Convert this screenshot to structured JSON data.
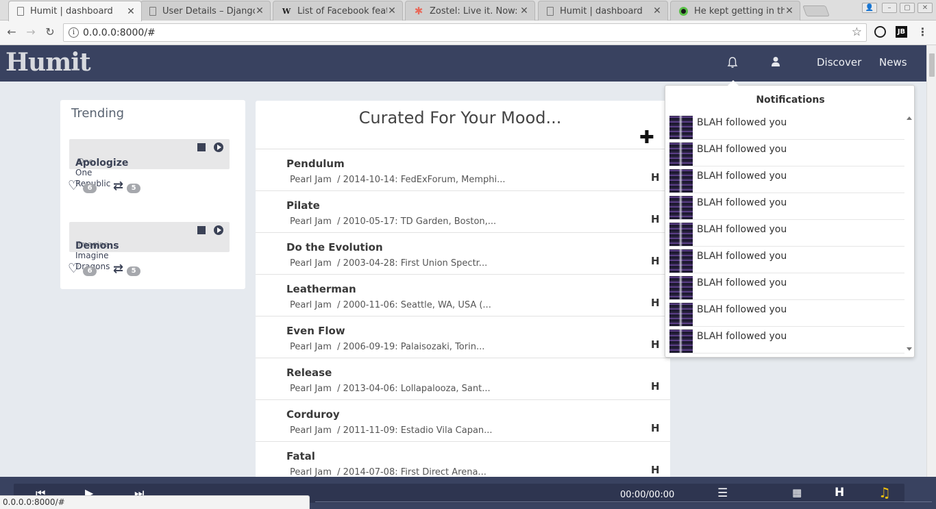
{
  "browser": {
    "tabs": [
      {
        "title": "Humit | dashboard",
        "icon": "page-icon"
      },
      {
        "title": "User Details – Django",
        "icon": "page-icon"
      },
      {
        "title": "List of Facebook features",
        "icon": "wikipedia-icon"
      },
      {
        "title": "Zostel: Live it. Now: In",
        "icon": "zostel-icon"
      },
      {
        "title": "Humit | dashboard",
        "icon": "page-icon"
      },
      {
        "title": "He kept getting in the",
        "icon": "green-dot-icon"
      }
    ],
    "url": "0.0.0.0:8000/#",
    "status_url": "0.0.0.0:8000/#",
    "extension_jb_label": "JB"
  },
  "app": {
    "logo_text": "Humit",
    "nav": {
      "discover": "Discover",
      "news": "News"
    }
  },
  "trending": {
    "title": "Trending",
    "items": [
      {
        "song": "Apologize",
        "artist": "One Republic",
        "ghost": "One",
        "likes": "6",
        "reposts": "5"
      },
      {
        "song": "Demons",
        "artist": "Imagine Dragons",
        "ghost": "Imagine",
        "likes": "6",
        "reposts": "5"
      }
    ]
  },
  "curated": {
    "title": "Curated For Your Mood...",
    "songs": [
      {
        "title": "Pendulum",
        "meta": "Pearl Jam  / 2014-10-14: FedExForum, Memphi..."
      },
      {
        "title": "Pilate",
        "meta": "Pearl Jam  / 2010-05-17: TD Garden, Boston,..."
      },
      {
        "title": "Do the Evolution",
        "meta": "Pearl Jam  / 2003-04-28: First Union Spectr..."
      },
      {
        "title": "Leatherman",
        "meta": "Pearl Jam  / 2000-11-06: Seattle, WA, USA (..."
      },
      {
        "title": "Even Flow",
        "meta": "Pearl Jam  / 2006-09-19: Palaisozaki, Torin..."
      },
      {
        "title": "Release",
        "meta": "Pearl Jam  / 2013-04-06: Lollapalooza, Sant..."
      },
      {
        "title": "Corduroy",
        "meta": "Pearl Jam  / 2011-11-09: Estadio Vila Capan..."
      },
      {
        "title": "Fatal",
        "meta": "Pearl Jam  / 2014-07-08: First Direct Arena..."
      }
    ],
    "h_label": "H"
  },
  "notifications": {
    "title": "Notifications",
    "items": [
      "BLAH followed you",
      "BLAH followed you",
      "BLAH followed you",
      "BLAH followed you",
      "BLAH followed you",
      "BLAH followed you",
      "BLAH followed you",
      "BLAH followed you",
      "BLAH followed you"
    ]
  },
  "player": {
    "time": "00:00/00:00",
    "h_label": "H"
  },
  "colors": {
    "header_bg": "#394260",
    "page_bg": "#e6eaef"
  }
}
